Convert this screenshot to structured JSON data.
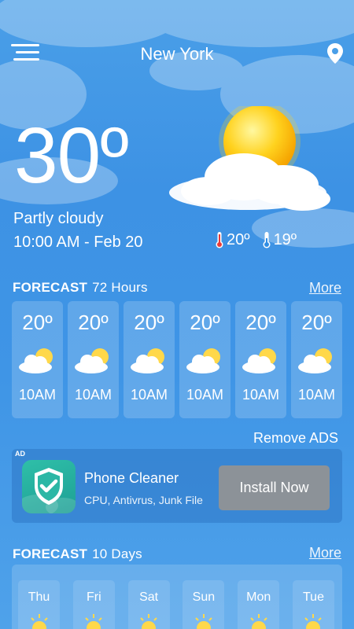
{
  "header": {
    "city": "New York"
  },
  "current": {
    "temperature": "30º",
    "condition": "Partly cloudy",
    "datetime": "10:00 AM - Feb 20",
    "high": "20º",
    "low": "19º"
  },
  "hourly": {
    "title": "FORECAST",
    "subtitle": "72 Hours",
    "more_label": "More",
    "items": [
      {
        "temp": "20º",
        "time": "10AM",
        "icon": "partly-cloudy-icon"
      },
      {
        "temp": "20º",
        "time": "10AM",
        "icon": "partly-cloudy-icon"
      },
      {
        "temp": "20º",
        "time": "10AM",
        "icon": "partly-cloudy-icon"
      },
      {
        "temp": "20º",
        "time": "10AM",
        "icon": "partly-cloudy-icon"
      },
      {
        "temp": "20º",
        "time": "10AM",
        "icon": "partly-cloudy-icon"
      },
      {
        "temp": "20º",
        "time": "10AM",
        "icon": "partly-cloudy-icon"
      }
    ]
  },
  "ad": {
    "remove_label": "Remove ADS",
    "tag": "AD",
    "title": "Phone Cleaner",
    "description": "CPU, Antivrus, Junk File",
    "button": "Install Now",
    "icon": "shield-check-icon",
    "button_color": "#8c9298"
  },
  "daily": {
    "title": "FORECAST",
    "subtitle": "10 Days",
    "more_label": "More",
    "items": [
      {
        "day": "Thu",
        "icon": "sun-icon"
      },
      {
        "day": "Fri",
        "icon": "sun-icon"
      },
      {
        "day": "Sat",
        "icon": "sun-icon"
      },
      {
        "day": "Sun",
        "icon": "sun-icon"
      },
      {
        "day": "Mon",
        "icon": "sun-icon"
      },
      {
        "day": "Tue",
        "icon": "sun-icon"
      }
    ]
  }
}
